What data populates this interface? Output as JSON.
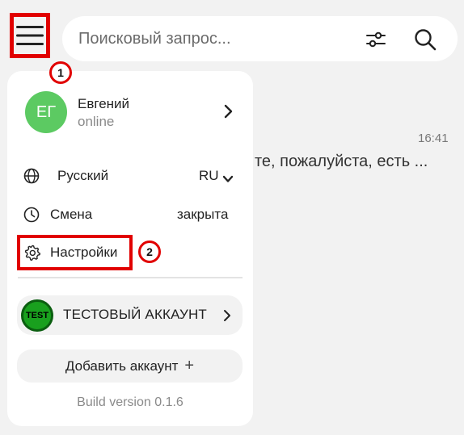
{
  "header": {
    "search_placeholder": "Поисковый запрос...",
    "menu_icon": "hamburger-icon",
    "filter_icon": "sliders-icon",
    "search_icon": "search-icon"
  },
  "background_chat": {
    "time": "16:41",
    "message_fragment": "те, пожалуйста, есть ..."
  },
  "markers": [
    "1",
    "2"
  ],
  "menu": {
    "profile": {
      "initials": "ЕГ",
      "name": "Евгений",
      "status": "online"
    },
    "language": {
      "label": "Русский",
      "value": "RU"
    },
    "shift": {
      "label": "Смена",
      "value": "закрыта"
    },
    "settings": {
      "label": "Настройки"
    },
    "account": {
      "logo_text": "TEST",
      "name": "ТЕСТОВЫЙ АККАУНТ"
    },
    "add_account": {
      "label": "Добавить аккаунт",
      "icon": "+"
    },
    "build": "Build version 0.1.6"
  },
  "colors": {
    "accent_red": "#e10000",
    "avatar_green": "#5cca62",
    "test_logo_green": "#19a01e"
  }
}
